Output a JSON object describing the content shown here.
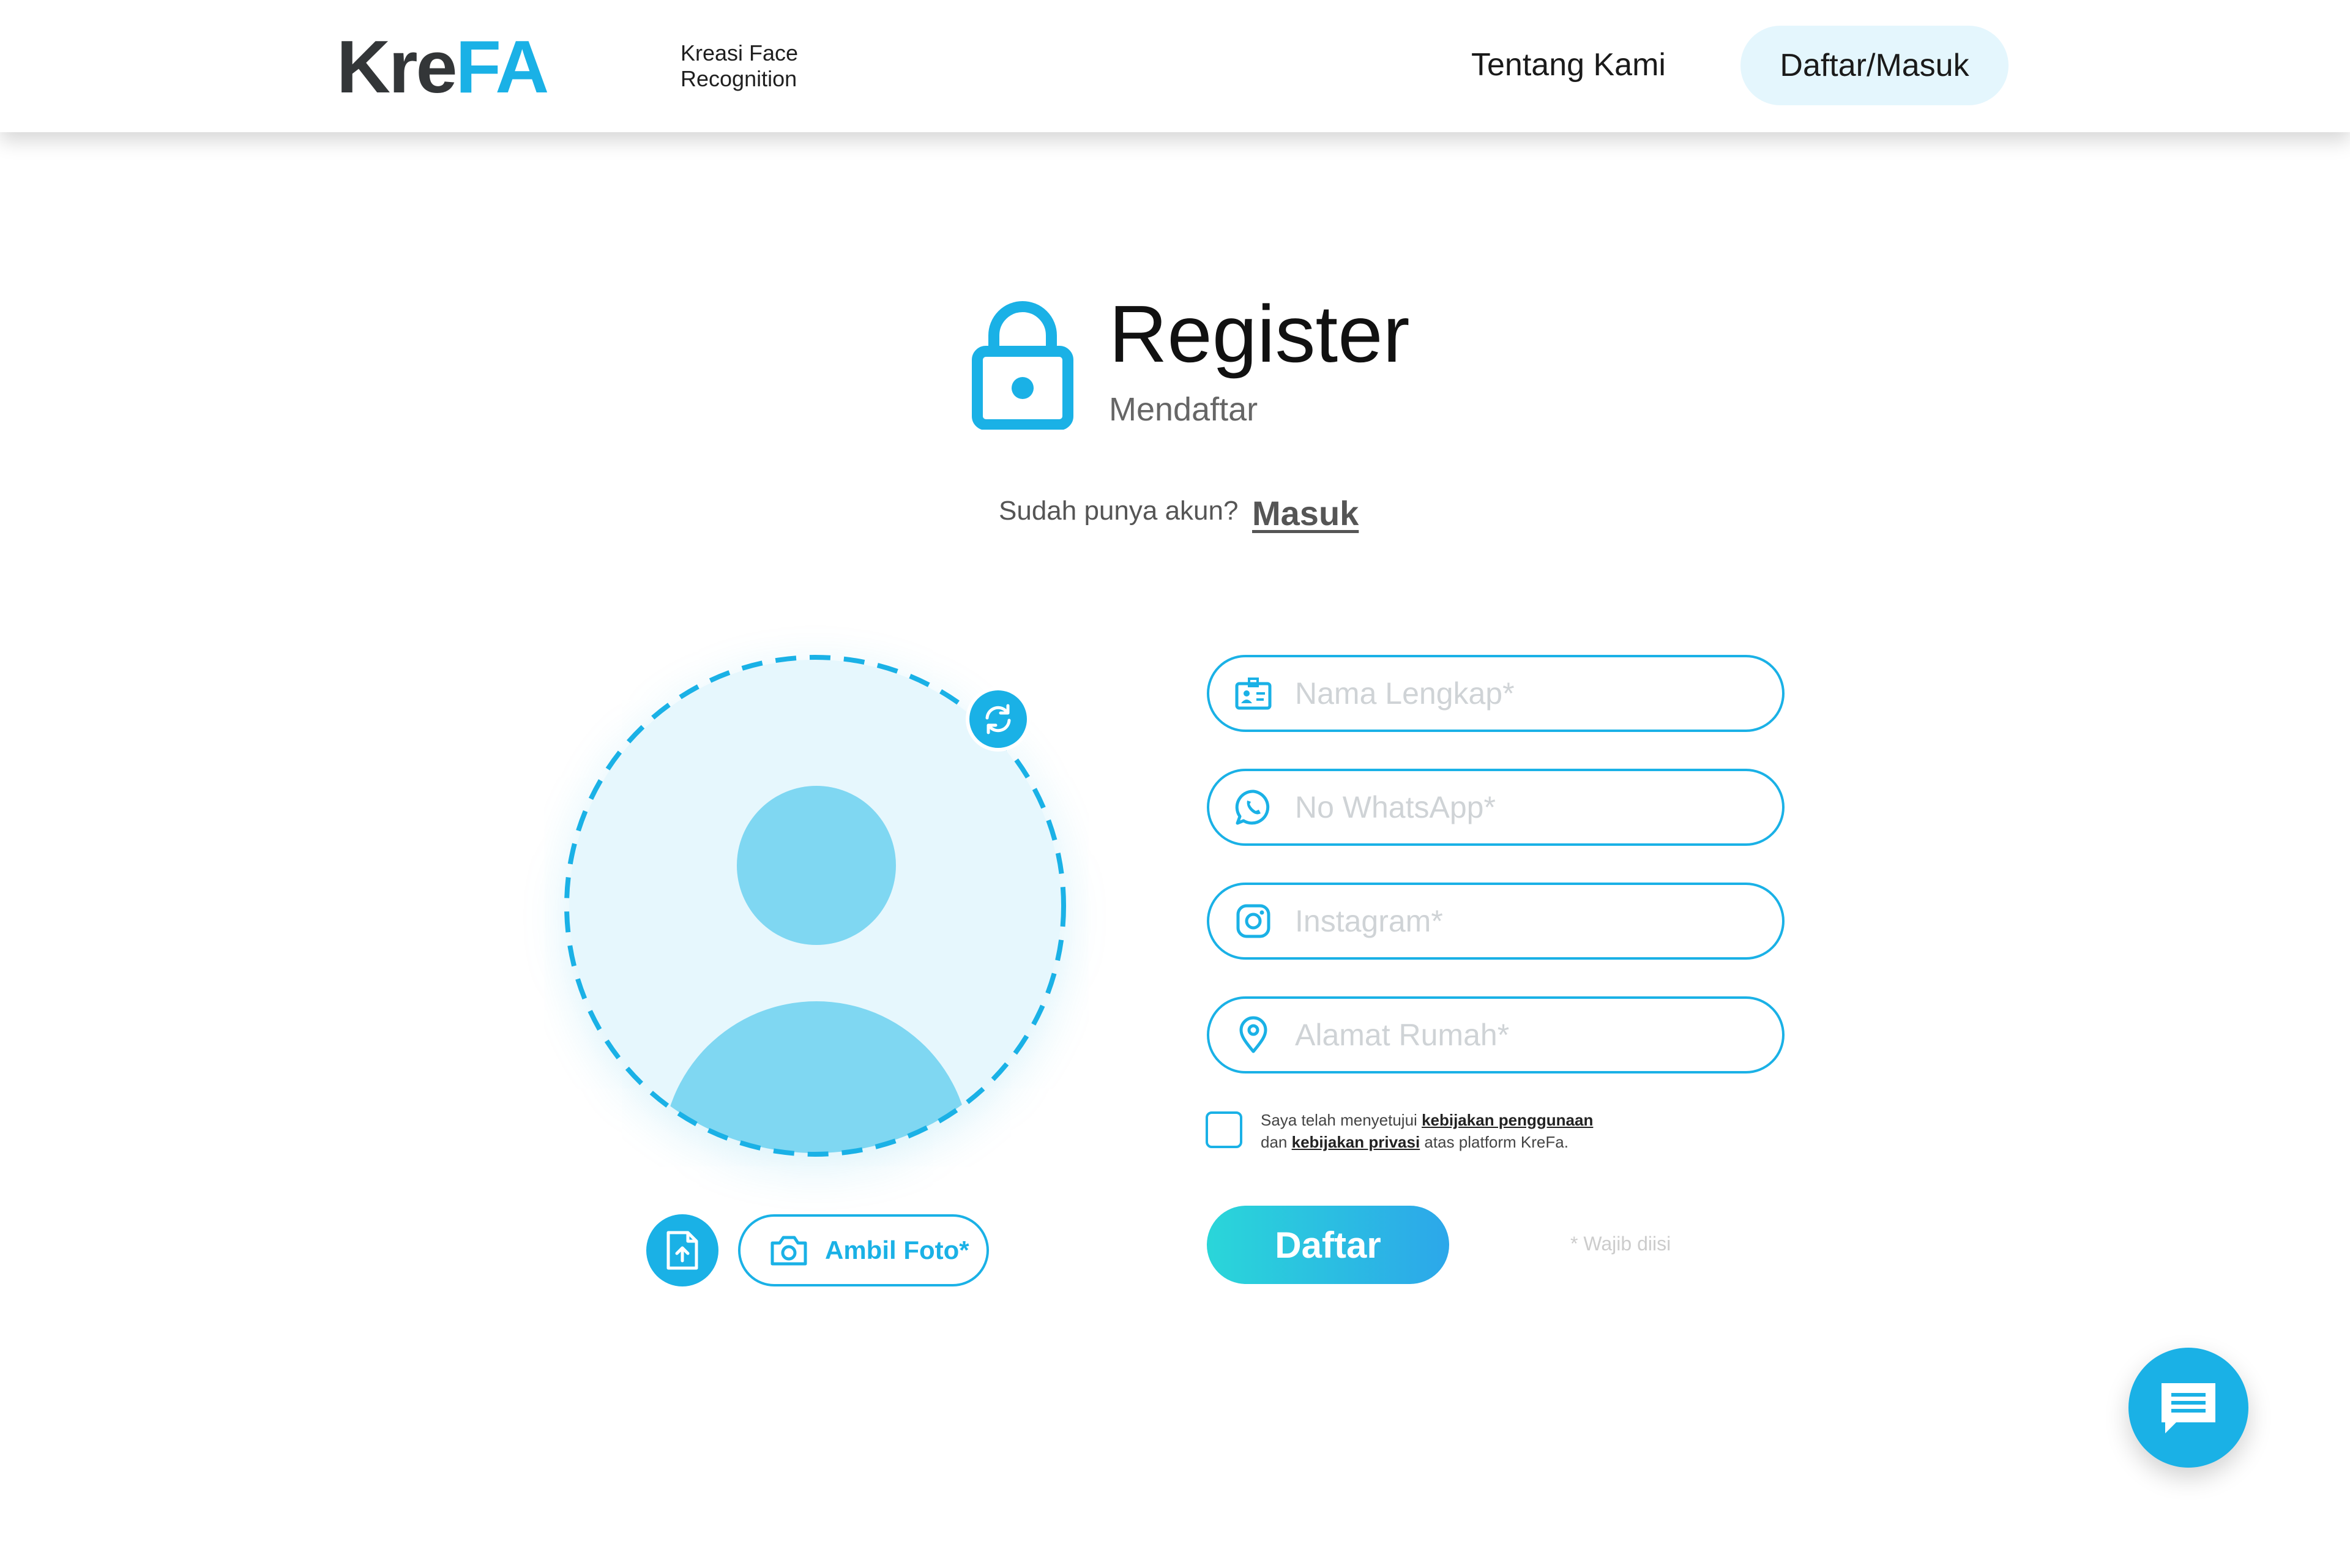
{
  "header": {
    "logo_part1": "Kre",
    "logo_part2": "FA",
    "tagline_line1": "Kreasi Face",
    "tagline_line2": "Recognition",
    "nav_about": "Tentang Kami",
    "nav_auth": "Daftar/Masuk"
  },
  "title": {
    "heading": "Register",
    "subheading": "Mendaftar",
    "lock_icon": "lock-icon"
  },
  "login_prompt": {
    "text": "Sudah punya akun?",
    "link": "Masuk"
  },
  "avatar": {
    "refresh_icon": "refresh-icon",
    "upload_icon": "file-upload-icon",
    "camera_icon": "camera-icon",
    "camera_label": "Ambil Foto*"
  },
  "form": {
    "fields": [
      {
        "icon": "id-card-icon",
        "placeholder": "Nama Lengkap*",
        "value": ""
      },
      {
        "icon": "whatsapp-icon",
        "placeholder": "No WhatsApp*",
        "value": ""
      },
      {
        "icon": "instagram-icon",
        "placeholder": "Instagram*",
        "value": ""
      },
      {
        "icon": "location-pin-icon",
        "placeholder": "Alamat Rumah*",
        "value": ""
      }
    ],
    "terms": {
      "prefix": "Saya telah menyetujui",
      "link1": "kebijakan penggunaan",
      "middle": "dan",
      "link2": "kebijakan privasi",
      "suffix": "atas platform KreFa."
    },
    "submit_label": "Daftar",
    "required_note": "* Wajib diisi"
  },
  "chat": {
    "icon": "chat-icon"
  },
  "colors": {
    "accent": "#1ab1e6",
    "accent_light": "#e6f7fd",
    "avatar_fill": "#7fd7f2",
    "gradient_start": "#2ad6d9",
    "gradient_end": "#2ca7ea"
  }
}
